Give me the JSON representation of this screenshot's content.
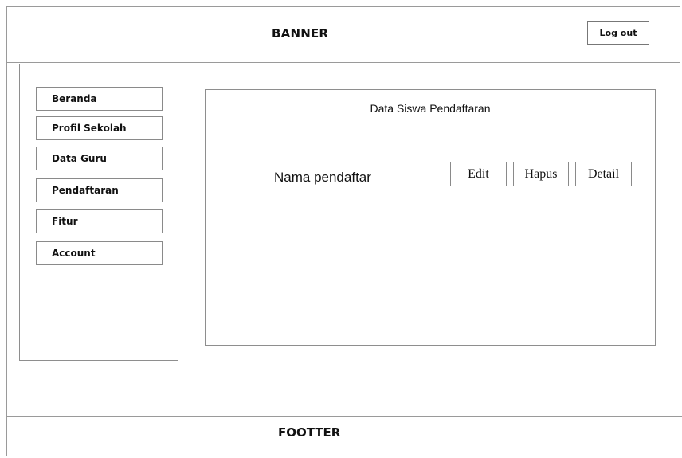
{
  "header": {
    "banner_text": "BANNER",
    "logout_label": "Log out"
  },
  "sidebar": {
    "items": [
      {
        "label": "Beranda"
      },
      {
        "label": "Profil Sekolah"
      },
      {
        "label": "Data Guru"
      },
      {
        "label": "Pendaftaran"
      },
      {
        "label": "Fitur"
      },
      {
        "label": "Account"
      }
    ]
  },
  "main": {
    "title": "Data Siswa Pendaftaran",
    "row": {
      "name": "Nama pendaftar",
      "edit_label": "Edit",
      "delete_label": "Hapus",
      "detail_label": "Detail"
    }
  },
  "footer": {
    "text": "FOOTTER"
  }
}
